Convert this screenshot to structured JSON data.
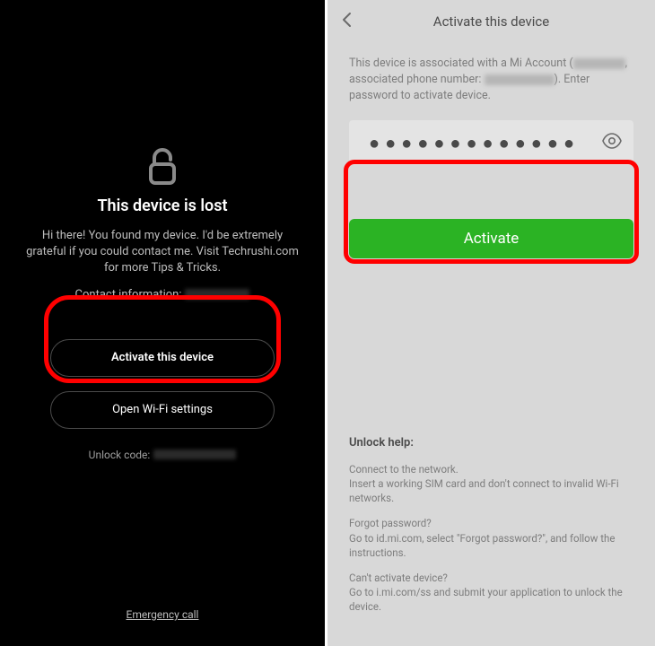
{
  "left": {
    "title": "This device is lost",
    "message": "Hi there! You found my device. I'd be extremely grateful if you could contact me. Visit Techrushi.com for more Tips & Tricks.",
    "contact_label": "Contact information:",
    "activate_label": "Activate this device",
    "wifi_label": "Open Wi-Fi settings",
    "unlock_label": "Unlock code:",
    "emergency_label": "Emergency call"
  },
  "right": {
    "header_title": "Activate this device",
    "account_prefix": "This device is associated with a Mi Account (",
    "account_mid": " associated phone number: ",
    "account_suffix": "). Enter password to activate device.",
    "password_dots": "●●●●●●●●●●●●●",
    "activate_label": "Activate",
    "help_title": "Unlock help:",
    "help_1a": "Connect to the network.",
    "help_1b": "Insert a working SIM card and don't connect to invalid Wi-Fi networks.",
    "help_2a": "Forgot password?",
    "help_2b": "Go to id.mi.com, select \"Forgot password?\", and follow the instructions.",
    "help_3a": "Can't activate device?",
    "help_3b": "Go to i.mi.com/ss and submit your application to unlock the device."
  }
}
